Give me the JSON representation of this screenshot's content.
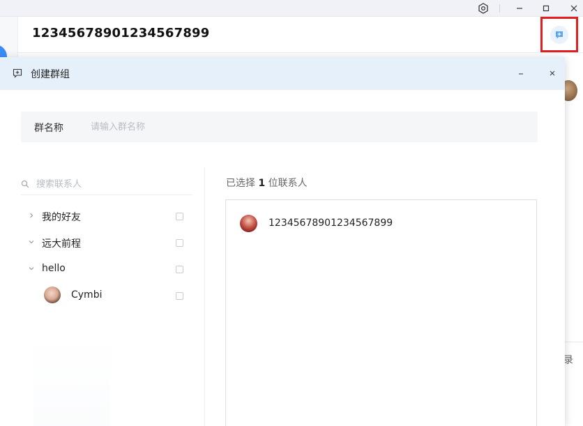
{
  "window": {
    "settings_icon": "hexagon-gear-icon",
    "minimize_icon": "minimize-icon",
    "maximize_icon": "maximize-icon",
    "close_icon": "close-icon"
  },
  "chat": {
    "title": "12345678901234567899",
    "create_group_icon": "chat-plus-icon",
    "partial_link": "录"
  },
  "dialog": {
    "title": "创建群组",
    "group_name_label": "群名称",
    "group_name_placeholder": "请输入群名称",
    "group_name_value": "",
    "search_placeholder": "搜索联系人",
    "groups": [
      {
        "label": "我的好友",
        "expanded": false,
        "checked": false
      },
      {
        "label": "远大前程",
        "expanded": true,
        "checked": false
      },
      {
        "label": "hello",
        "expanded": true,
        "checked": false
      }
    ],
    "contacts": [
      {
        "name": "Cymbi",
        "group": "hello",
        "checked": false
      }
    ],
    "selected_prefix": "已选择",
    "selected_count": "1",
    "selected_suffix": "位联系人",
    "selected": [
      {
        "name": "12345678901234567899"
      }
    ]
  },
  "colors": {
    "accent_blue": "#3b8cf7",
    "dialog_header_bg": "#e6f0fb",
    "highlight_red": "#e02020"
  }
}
